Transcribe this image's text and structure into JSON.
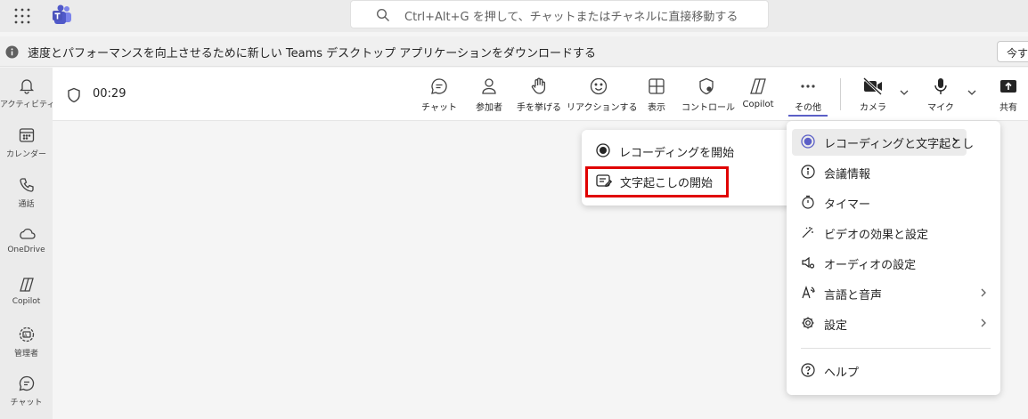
{
  "titlebar": {
    "search_placeholder": "Ctrl+Alt+G を押して、チャットまたはチャネルに直接移動する",
    "icons": [
      "app-grid-icon",
      "teams-logo-icon",
      "search-icon"
    ]
  },
  "banner": {
    "message": "速度とパフォーマンスを向上させるために新しい Teams デスクトップ アプリケーションをダウンロードする",
    "button_label": "今すぐ"
  },
  "rail": {
    "items": [
      {
        "label": "アクティビティ",
        "icon": "bell-icon"
      },
      {
        "label": "カレンダー",
        "icon": "calendar-icon"
      },
      {
        "label": "通話",
        "icon": "phone-icon"
      },
      {
        "label": "OneDrive",
        "icon": "cloud-icon"
      },
      {
        "label": "Copilot",
        "icon": "copilot-icon"
      },
      {
        "label": "管理者",
        "icon": "admin-icon"
      },
      {
        "label": "チャット",
        "icon": "chat-icon"
      }
    ]
  },
  "meeting": {
    "elapsed": "00:29",
    "toolbar": [
      {
        "label": "チャット",
        "icon": "chat-icon"
      },
      {
        "label": "参加者",
        "icon": "people-icon"
      },
      {
        "label": "手を挙げる",
        "icon": "raise-hand-icon"
      },
      {
        "label": "リアクションする",
        "icon": "emoji-icon"
      },
      {
        "label": "表示",
        "icon": "view-grid-icon"
      },
      {
        "label": "コントロール",
        "icon": "shield-settings-icon"
      },
      {
        "label": "Copilot",
        "icon": "copilot-icon"
      },
      {
        "label": "その他",
        "icon": "more-icon",
        "active": true
      },
      {
        "label": "カメラ",
        "icon": "camera-off-icon"
      },
      {
        "label": "マイク",
        "icon": "mic-icon"
      },
      {
        "label": "共有",
        "icon": "share-icon"
      }
    ]
  },
  "more_menu": {
    "items": [
      {
        "label": "レコーディングと文字起こし",
        "icon": "record-icon",
        "submenu": true,
        "highlighted": true
      },
      {
        "label": "会議情報",
        "icon": "info-icon"
      },
      {
        "label": "タイマー",
        "icon": "timer-icon"
      },
      {
        "label": "ビデオの効果と設定",
        "icon": "magic-wand-icon"
      },
      {
        "label": "オーディオの設定",
        "icon": "speaker-settings-icon"
      },
      {
        "label": "言語と音声",
        "icon": "language-icon",
        "submenu": true
      },
      {
        "label": "設定",
        "icon": "gear-icon",
        "submenu": true
      },
      {
        "label": "ヘルプ",
        "icon": "help-icon"
      }
    ]
  },
  "sub_menu": {
    "items": [
      {
        "label": "レコーディングを開始",
        "icon": "record-icon"
      },
      {
        "label": "文字起こしの開始",
        "icon": "transcript-icon",
        "highlighted_by_annotation": true
      }
    ]
  },
  "annotation_color": "#e00000",
  "accent_color": "#5b5fc7"
}
